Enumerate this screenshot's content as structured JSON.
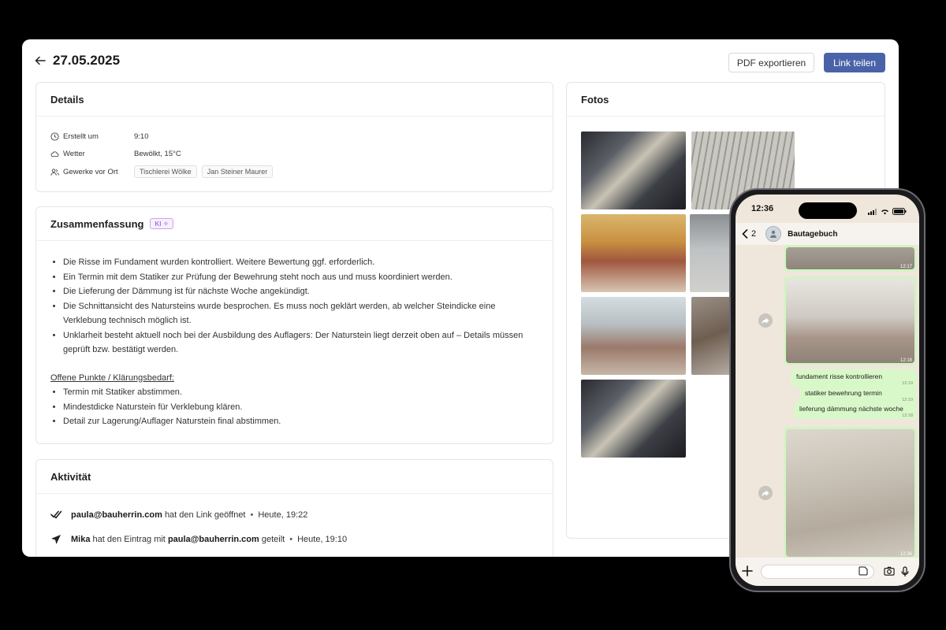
{
  "header": {
    "date": "27.05.2025",
    "pdf_label": "PDF exportieren",
    "share_label": "Link teilen"
  },
  "details": {
    "title": "Details",
    "created_label": "Erstellt um",
    "created_value": "9:10",
    "weather_label": "Wetter",
    "weather_value": "Bewölkt, 15°C",
    "trades_label": "Gewerke vor Ort",
    "trades": [
      "Tischlerei Wölke",
      "Jan Steiner Maurer"
    ]
  },
  "summary": {
    "title": "Zusammenfassung",
    "badge": "KI",
    "bullets": [
      "Die Risse im Fundament wurden kontrolliert. Weitere Bewertung ggf. erforderlich.",
      "Ein Termin mit dem Statiker zur Prüfung der Bewehrung steht noch aus und muss koordiniert werden.",
      "Die Lieferung der Dämmung ist für nächste Woche angekündigt.",
      "Die Schnittansicht des Natursteins wurde besprochen. Es muss noch geklärt werden, ab welcher Steindicke eine Verklebung technisch möglich ist.",
      "Unklarheit besteht aktuell noch bei der Ausbildung des Auflagers: Der Naturstein liegt derzeit oben auf – Details müssen geprüft bzw. bestätigt werden."
    ],
    "open_title": "Offene Punkte / Klärungsbedarf:",
    "open_items": [
      "Termin mit Statiker abstimmen.",
      "Mindestdicke Naturstein für Verklebung klären.",
      "Detail zur Lagerung/Auflager Naturstein final abstimmen."
    ]
  },
  "activity": {
    "title": "Aktivität",
    "row1": {
      "actor": "paula@bauherrin.com",
      "text": "hat den Link geöffnet",
      "time": "Heute, 19:22"
    },
    "row2": {
      "actor": "Mika",
      "text1": "hat den Eintrag mit",
      "target": "paula@bauherrin.com",
      "text2": "geteilt",
      "time": "Heute, 19:10"
    }
  },
  "photos": {
    "title": "Fotos"
  },
  "phone": {
    "time": "12:36",
    "back_count": "2",
    "chat_name": "Bautagebuch",
    "img1_time": "12:17",
    "img2_time": "12:18",
    "img3_time": "12:36",
    "messages": [
      {
        "text": "fundament risse kontrollieren",
        "time": "12:19"
      },
      {
        "text": "statiker bewehrung termin",
        "time": "12:19"
      },
      {
        "text": "lieferung dämmung nächste woche",
        "time": "12:18"
      }
    ]
  },
  "colors": {
    "primary": "#4a63a8",
    "bubble": "#d9f8c9",
    "chat_bg": "#efe7dc"
  },
  "icons": [
    "back-arrow-icon",
    "clock-icon",
    "cloud-icon",
    "people-icon",
    "double-check-icon",
    "send-icon",
    "forward-icon",
    "plus-icon",
    "sticker-icon",
    "camera-icon",
    "mic-icon"
  ]
}
